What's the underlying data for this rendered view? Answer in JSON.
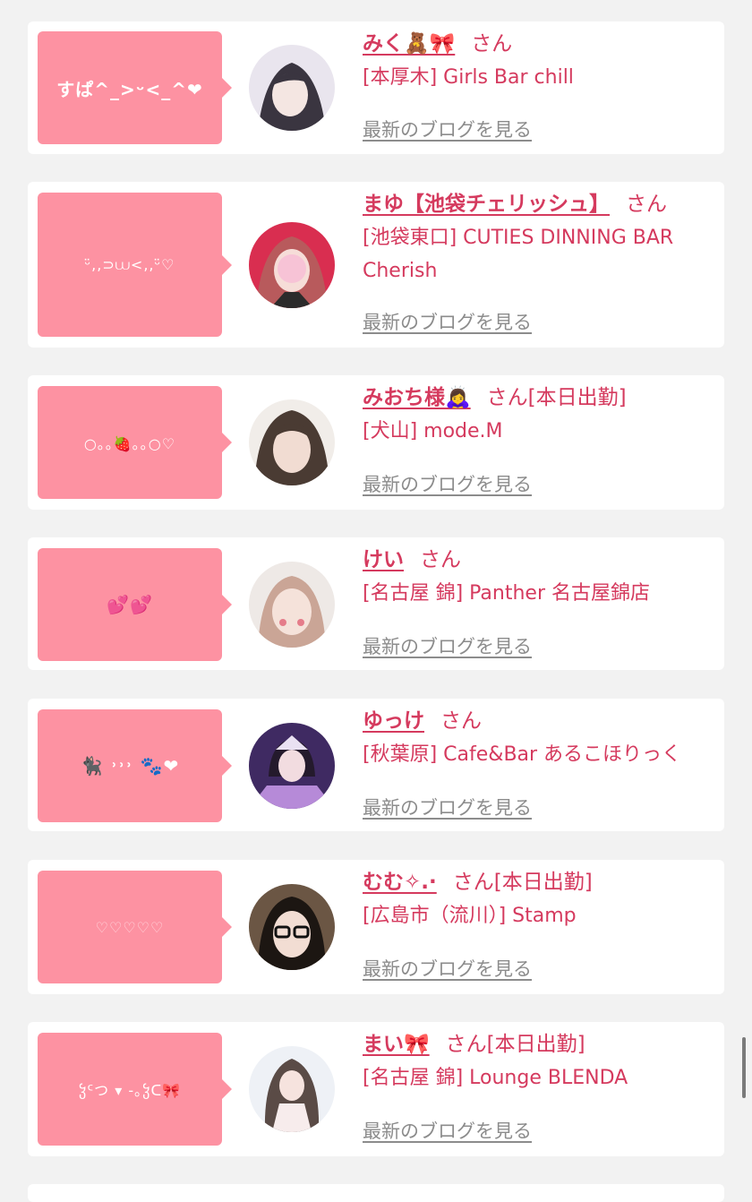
{
  "blog_link_label": "最新のブログを見る",
  "san_label": "さん",
  "cards": [
    {
      "bubble": "すぱ^_>ᵕ<_^❤",
      "name": "みく🧸🎀",
      "status": "",
      "shop": "[本厚木] Girls Bar chill",
      "avatar_colors": [
        "#e9e5ee",
        "#3a3540"
      ]
    },
    {
      "bubble": "ᵕ̈,,⊃⩊<,,ᵕ̈♡",
      "name": "まゆ【池袋チェリッシュ】",
      "status": "",
      "shop": "[池袋東口] CUTIES DINNING BAR Cherish",
      "avatar_colors": [
        "#d92e50",
        "#f4cfd0"
      ]
    },
    {
      "bubble": "○｡｡🍓｡｡○♡",
      "name": "みおち様🙇‍♀️",
      "status": "[本日出勤]",
      "shop": "[犬山] mode.M",
      "avatar_colors": [
        "#f1ede9",
        "#4a3b33"
      ]
    },
    {
      "bubble": "💕💕",
      "name": "けい",
      "status": "",
      "shop": "[名古屋 錦] Panther 名古屋錦店",
      "avatar_colors": [
        "#eee9e6",
        "#caa596"
      ]
    },
    {
      "bubble": "🐈‍⬛ ˒˒˒ 🐾❤",
      "name": "ゆっけ",
      "status": "",
      "shop": "[秋葉原] Cafe&Bar あるこほりっく",
      "avatar_colors": [
        "#3f2a62",
        "#b68ad8"
      ]
    },
    {
      "bubble": "♡♡♡♡♡",
      "name": "むむ✧.·",
      "status": "[本日出勤]",
      "shop": "[広島市（流川）] Stamp",
      "avatar_colors": [
        "#6b5644",
        "#1c1612"
      ]
    },
    {
      "bubble": "ჴᑦつ ▾ -｡ჴᑕ🎀",
      "name": "まい🎀",
      "status": "[本日出勤]",
      "shop": "[名古屋 錦] Lounge BLENDA",
      "avatar_colors": [
        "#eef1f6",
        "#5a4b46"
      ]
    }
  ]
}
